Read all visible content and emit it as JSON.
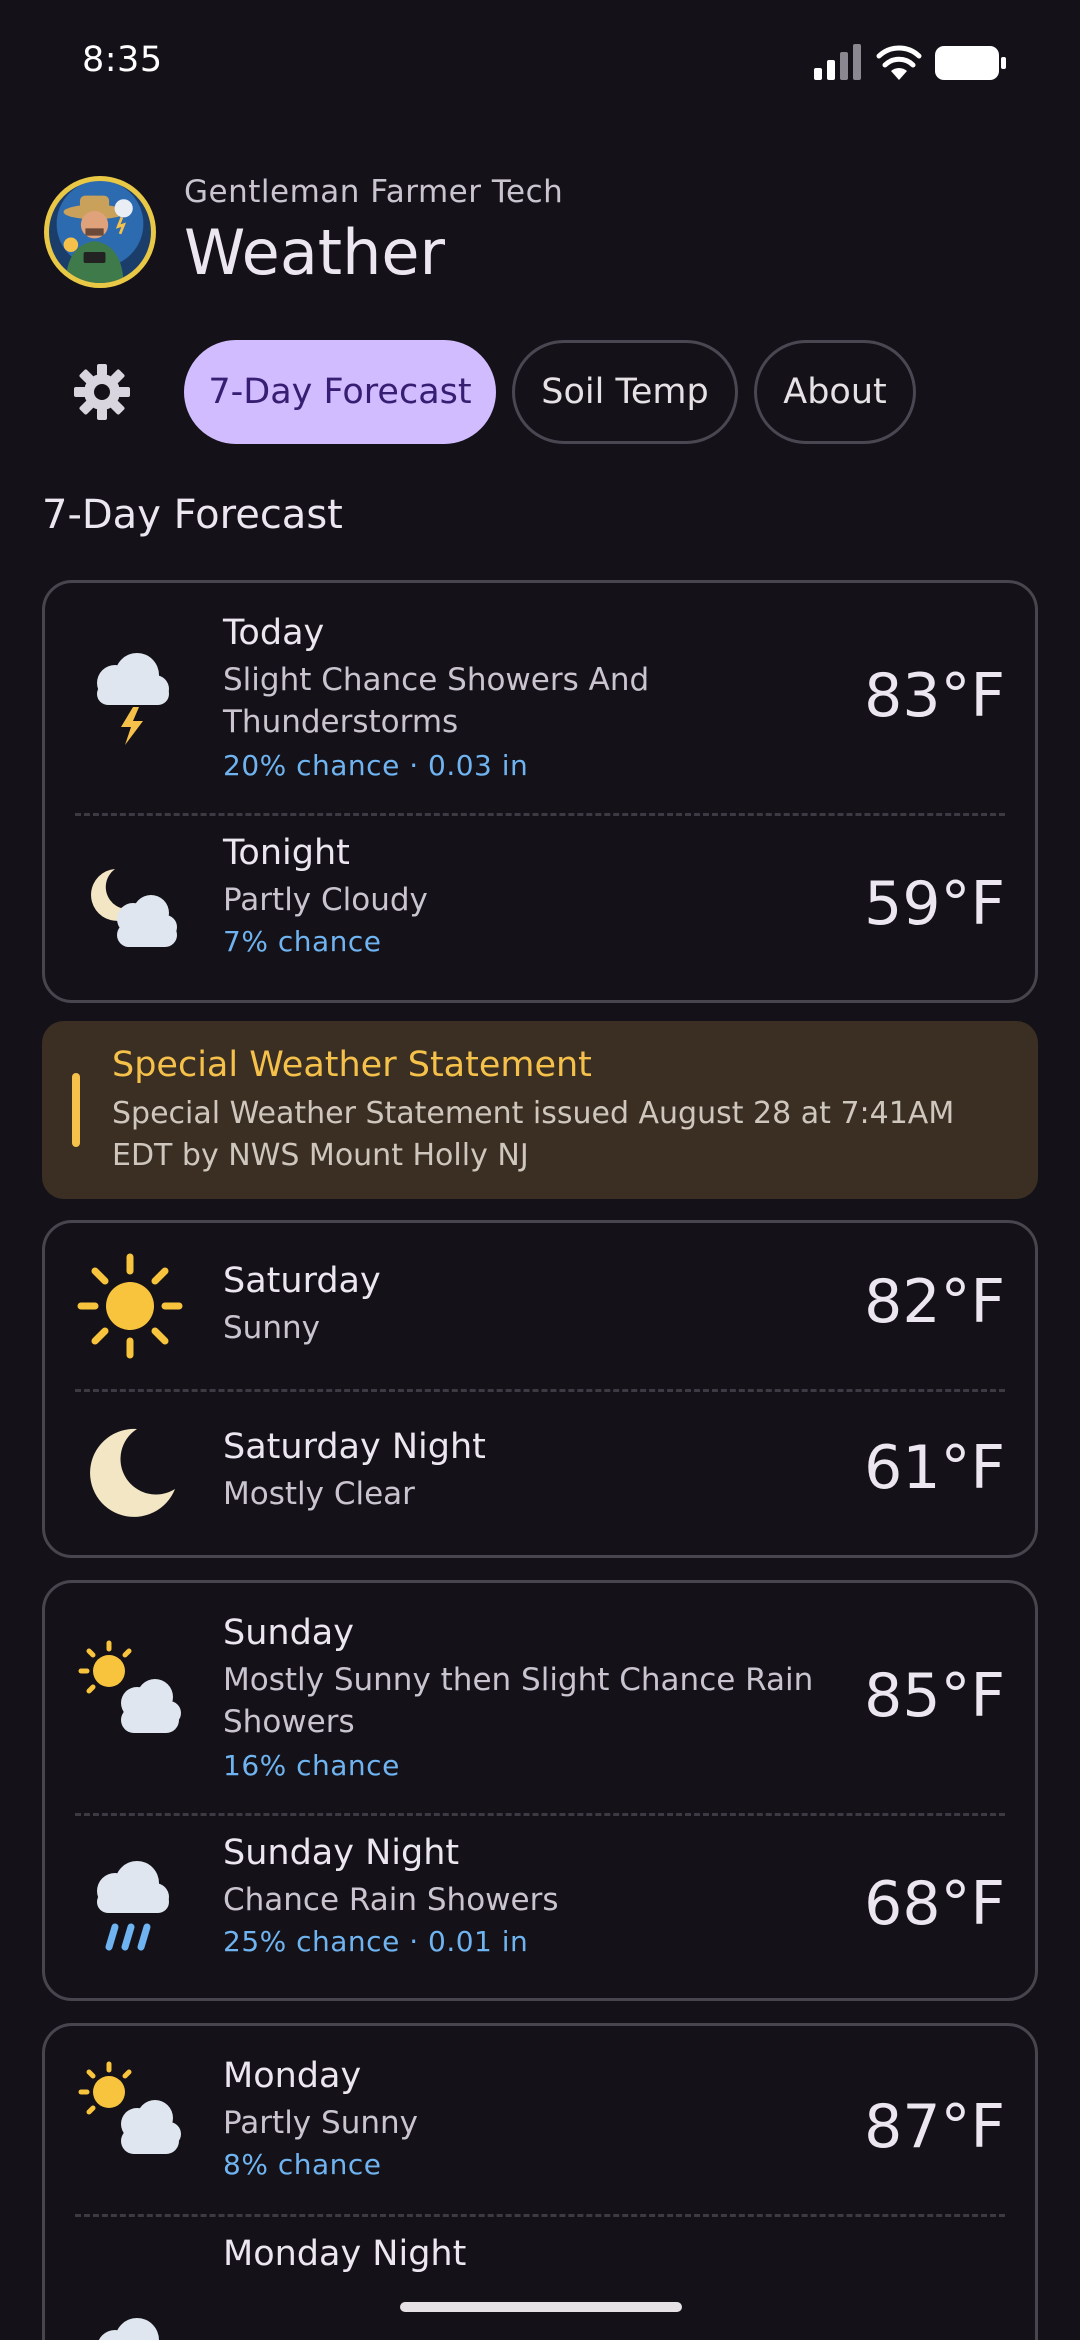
{
  "status_bar": {
    "time": "8:35"
  },
  "header": {
    "subtitle": "Gentleman Farmer Tech",
    "title": "Weather"
  },
  "tabs": [
    {
      "label": "7-Day Forecast",
      "active": true
    },
    {
      "label": "Soil Temp",
      "active": false
    },
    {
      "label": "About",
      "active": false
    }
  ],
  "section_title": "7-Day Forecast",
  "alert": {
    "title": "Special Weather Statement",
    "text": "Special Weather Statement issued August 28 at 7:41AM EDT by NWS Mount Holly NJ"
  },
  "forecast": [
    {
      "period": "Today",
      "description": "Slight Chance Showers And Thunderstorms",
      "precip": "20% chance · 0.03 in",
      "temp": "83°F",
      "icon": "thunderstorm-icon"
    },
    {
      "period": "Tonight",
      "description": "Partly Cloudy",
      "precip": "7% chance",
      "temp": "59°F",
      "icon": "moon-cloud-icon"
    },
    {
      "period": "Saturday",
      "description": "Sunny",
      "temp": "82°F",
      "icon": "sun-icon"
    },
    {
      "period": "Saturday Night",
      "description": "Mostly Clear",
      "temp": "61°F",
      "icon": "moon-icon"
    },
    {
      "period": "Sunday",
      "description": "Mostly Sunny then Slight Chance Rain Showers",
      "precip": "16% chance",
      "temp": "85°F",
      "icon": "sun-cloud-icon"
    },
    {
      "period": "Sunday Night",
      "description": "Chance Rain Showers",
      "precip": "25% chance · 0.01 in",
      "temp": "68°F",
      "icon": "rain-icon"
    },
    {
      "period": "Monday",
      "description": "Partly Sunny",
      "precip": "8% chance",
      "temp": "87°F",
      "icon": "sun-cloud-icon"
    },
    {
      "period": "Monday Night",
      "icon": "cloud-icon"
    }
  ],
  "colors": {
    "background": "#141218",
    "accent": "#d0bcff",
    "precip": "#6fb3f0",
    "alert": "#f5c14a",
    "sun": "#f8c33d"
  }
}
